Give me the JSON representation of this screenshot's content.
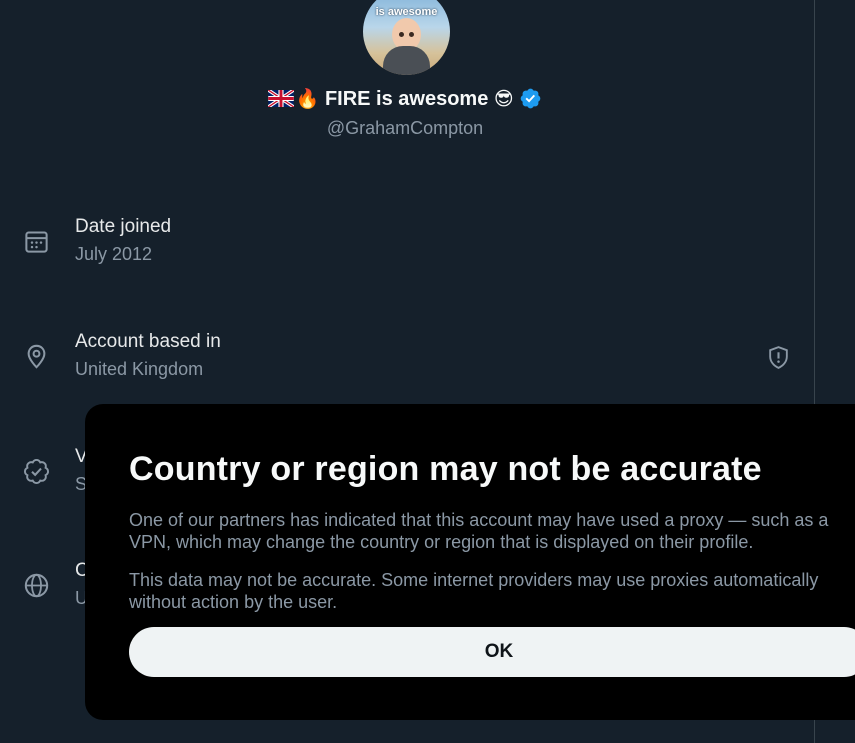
{
  "profile": {
    "display_name": "FIRE is awesome",
    "handle": "@GrahamCompton",
    "avatar_text": "is awesome",
    "flag_emoji": "uk-flag-icon",
    "fire_emoji": "🔥",
    "sunglasses_emoji": "😎",
    "verified_color": "#1d9bf0"
  },
  "rows": {
    "date_joined": {
      "label": "Date joined",
      "value": "July 2012"
    },
    "account_based": {
      "label": "Account based in",
      "value": "United Kingdom"
    },
    "verified": {
      "label_visible": "V",
      "value_visible": "S"
    },
    "connected": {
      "label_visible": "C",
      "value_visible": "U"
    }
  },
  "dialog": {
    "title": "Country or region may not be accurate",
    "paragraph1": "One of our partners has indicated that this account may have used a proxy — such as a VPN, which may change the country or region that is displayed on their profile.",
    "paragraph2": "This data may not be accurate. Some internet providers may use proxies automatically without action by the user.",
    "ok_label": "OK"
  },
  "colors": {
    "background": "#15202b",
    "secondary_text": "#8b98a5",
    "dialog_background": "#000000",
    "button_background": "#eff3f4"
  }
}
